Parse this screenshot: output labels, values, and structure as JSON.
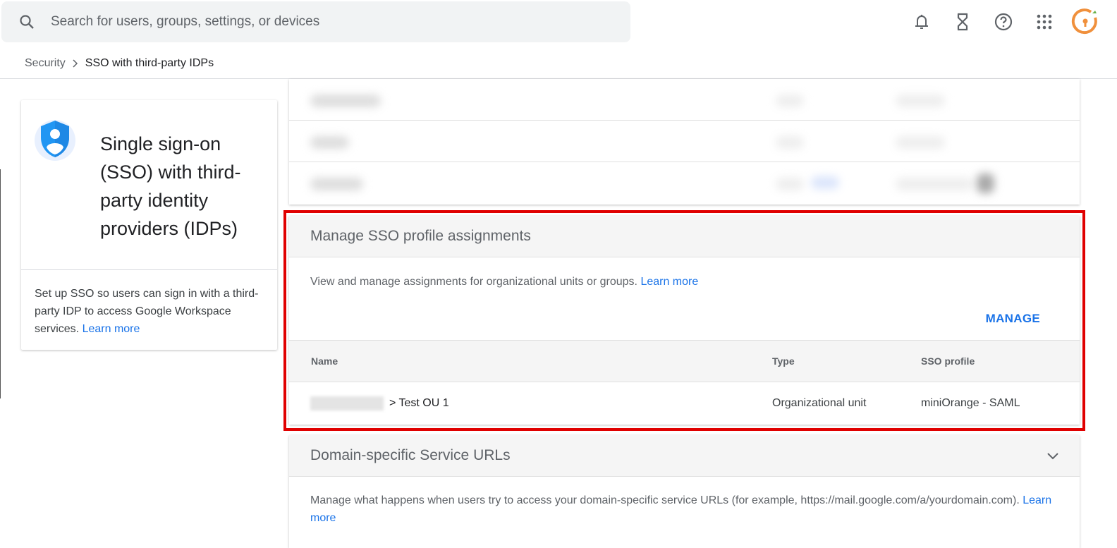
{
  "search": {
    "placeholder": "Search for users, groups, settings, or devices"
  },
  "header_icons": [
    "notifications-icon",
    "hourglass-icon",
    "help-icon",
    "apps-grid-icon",
    "account-avatar-logo"
  ],
  "breadcrumb": {
    "parent": "Security",
    "separator": ">",
    "current": "SSO with third-party IDPs"
  },
  "left_card": {
    "title": "Single sign-on (SSO) with third-party identity providers (IDPs)",
    "description": "Set up SSO so users can sign in with a third-party IDP to access Google Workspace services.",
    "learn_more": "Learn more"
  },
  "manage_section": {
    "title": "Manage SSO profile assignments",
    "description": "View and manage assignments for organizational units or groups.",
    "learn_more": "Learn more",
    "manage_button": "MANAGE",
    "columns": [
      "Name",
      "Type",
      "SSO profile"
    ],
    "rows": [
      {
        "name": "> Test OU 1",
        "type": "Organizational unit",
        "profile": "miniOrange - SAML"
      }
    ]
  },
  "domain_section": {
    "title": "Domain-specific Service URLs",
    "description": "Manage what happens when users try to access your domain-specific service URLs (for example, https://mail.google.com/a/yourdomain.com).",
    "learn_more": "Learn more"
  },
  "colors": {
    "accent": "#1a73e8",
    "highlight": "#e00000",
    "logo": "#f0903c"
  }
}
